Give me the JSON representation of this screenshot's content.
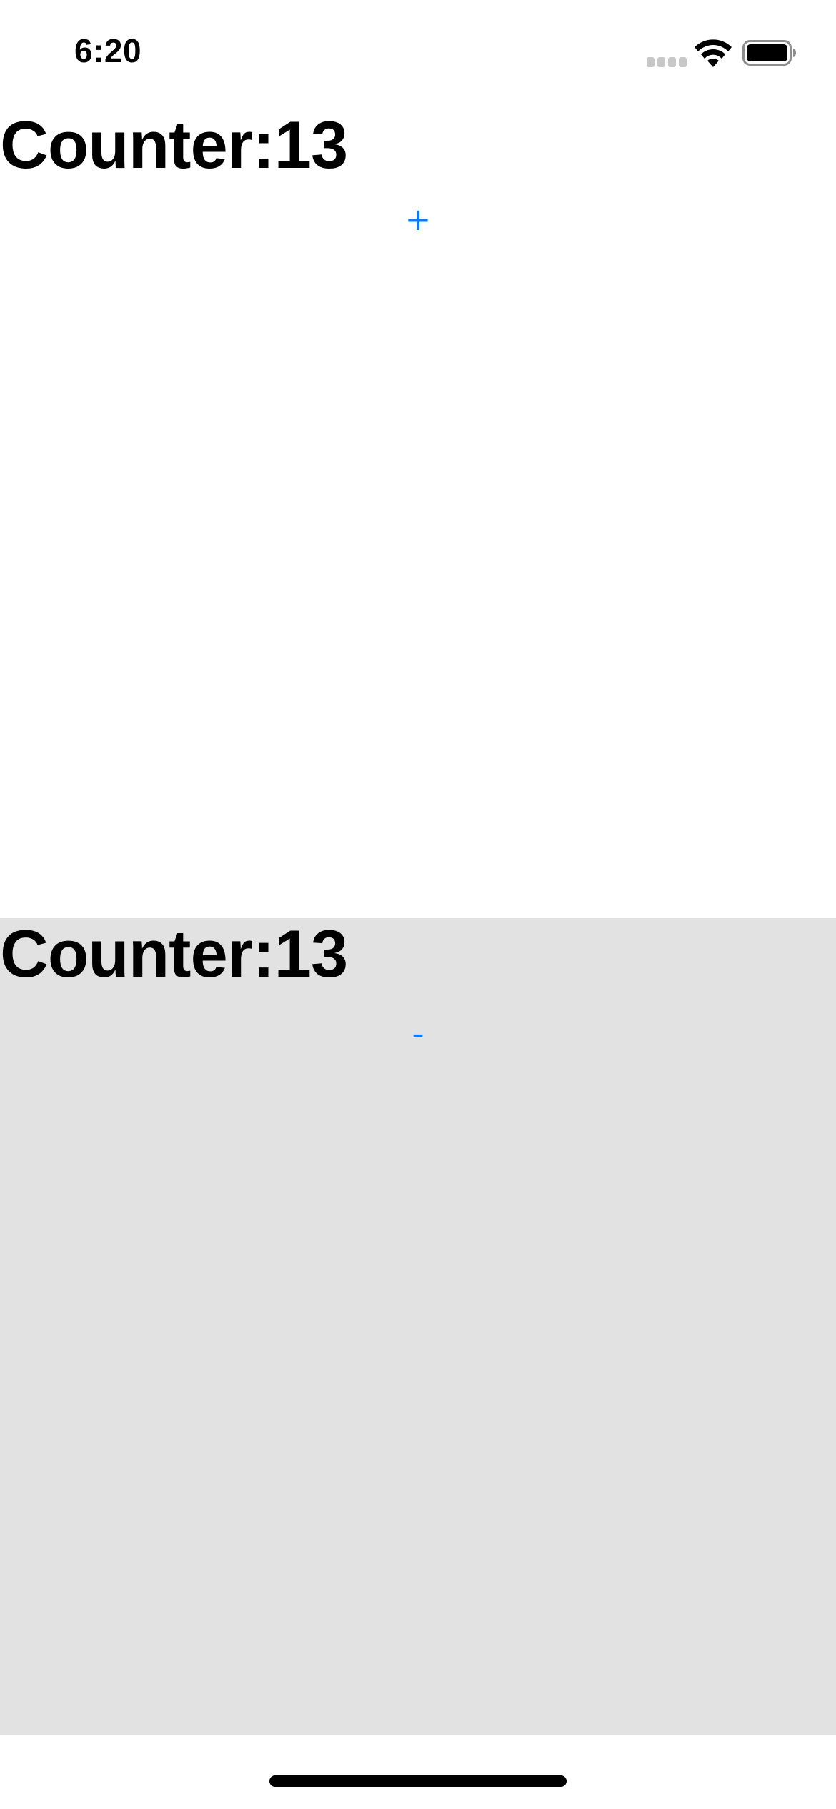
{
  "status_bar": {
    "time": "6:20",
    "signal_icon": "cellular-signal-icon",
    "wifi_icon": "wifi-icon",
    "battery_icon": "battery-full-icon"
  },
  "top_pane": {
    "counter_label": "Counter:13",
    "button_label": "+"
  },
  "bottom_pane": {
    "counter_label": "Counter:13",
    "button_label": "-"
  },
  "colors": {
    "accent": "#0a7aff",
    "bottom_pane_background": "#e2e2e2"
  }
}
